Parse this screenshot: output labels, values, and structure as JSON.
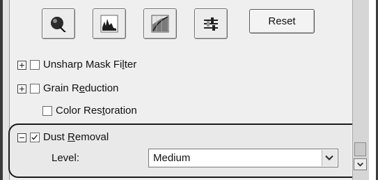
{
  "toolbar": {
    "tools": [
      {
        "name": "auto-exposure",
        "icon": "auto-exposure-icon"
      },
      {
        "name": "histogram",
        "icon": "histogram-icon"
      },
      {
        "name": "tone-correction",
        "icon": "tone-curve-icon"
      },
      {
        "name": "image-adjustment",
        "icon": "sliders-icon"
      }
    ],
    "reset_label": "Reset"
  },
  "options": {
    "unsharp": {
      "label_pre": "Unsharp Mask Fi",
      "label_u": "l",
      "label_post": "ter",
      "checked": false,
      "expander": "+"
    },
    "grain": {
      "label_pre": "Grain R",
      "label_u": "e",
      "label_post": "duction",
      "checked": false,
      "expander": "+"
    },
    "color": {
      "label_pre": "Color Res",
      "label_u": "t",
      "label_post": "oration",
      "checked": false
    },
    "dust": {
      "label_pre": "Dust ",
      "label_u": "R",
      "label_post": "emoval",
      "checked": true,
      "expander": "-"
    }
  },
  "level": {
    "label": "Level:",
    "value": "Medium"
  },
  "colors": {
    "panel": "#efefef",
    "highlight_ring": "#1a1a1a"
  }
}
